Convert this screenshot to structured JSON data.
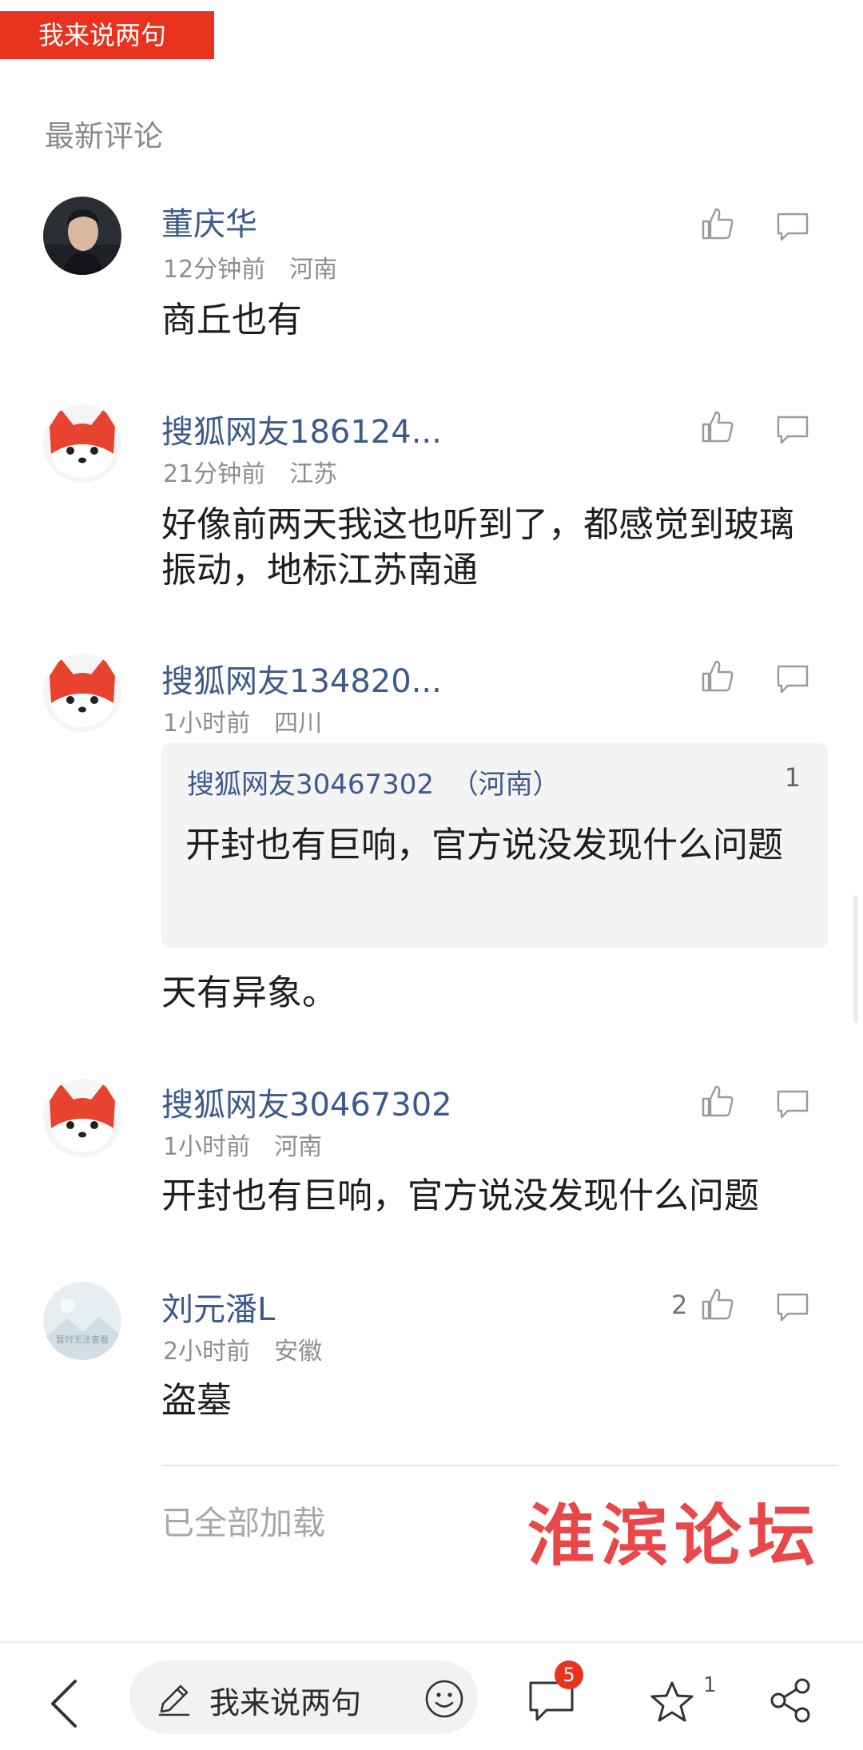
{
  "top_tag": "我来说两句",
  "section_title": "最新评论",
  "comments": [
    {
      "user": "董庆华",
      "time": "12分钟前",
      "location": "河南",
      "text": "商丘也有",
      "likes": ""
    },
    {
      "user": "搜狐网友186124...",
      "time": "21分钟前",
      "location": "江苏",
      "text": "好像前两天我这也听到了，都感觉到玻璃振动，地标江苏南通",
      "likes": ""
    },
    {
      "user": "搜狐网友134820...",
      "time": "1小时前",
      "location": "四川",
      "text": "天有异象。",
      "likes": "",
      "reply": {
        "user": "搜狐网友30467302",
        "location": "（河南）",
        "count": "1",
        "text": "开封也有巨响，官方说没发现什么问题"
      }
    },
    {
      "user": "搜狐网友30467302",
      "time": "1小时前",
      "location": "河南",
      "text": "开封也有巨响，官方说没发现什么问题",
      "likes": ""
    },
    {
      "user": "刘元潘L",
      "time": "2小时前",
      "location": "安徽",
      "text": "盗墓",
      "likes": "2"
    }
  ],
  "avatar_caption": "暂时无法查看",
  "footer_status": "已全部加载",
  "watermark": "淮滨论坛",
  "bottom_bar": {
    "input_placeholder": "我来说两句",
    "comment_badge": "5",
    "favorite_count": "1"
  },
  "icons": [
    "back-icon",
    "pen-icon",
    "emoji-icon",
    "comment-icon",
    "star-icon",
    "share-icon",
    "thumb-up-icon",
    "reply-icon"
  ],
  "colors": {
    "accent": "#e8321e",
    "username": "#3d5a8c",
    "watermark": "#e8484a"
  }
}
